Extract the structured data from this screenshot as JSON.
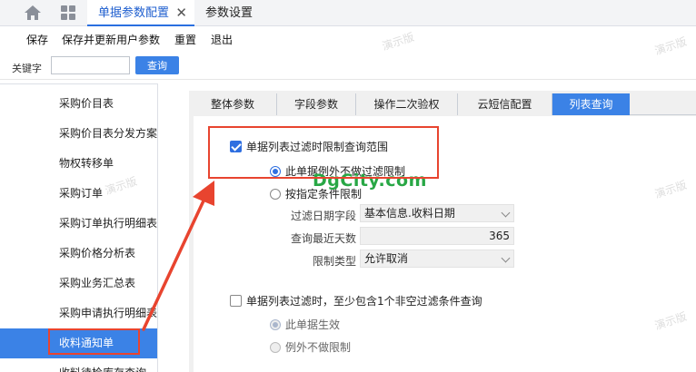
{
  "tabs": {
    "active_label": "单据参数配置",
    "close_symbol": "✕",
    "second_label": "参数设置",
    "home_icon": "home-icon",
    "grid_icon": "apps-grid-icon"
  },
  "toolbar": {
    "save": "保存",
    "save_update": "保存并更新用户参数",
    "reset": "重置",
    "exit": "退出"
  },
  "search": {
    "label": "关键字",
    "value": "",
    "button": "查询"
  },
  "sidebar": {
    "items": [
      {
        "label": "采购价目表"
      },
      {
        "label": "采购价目表分发方案"
      },
      {
        "label": "物权转移单"
      },
      {
        "label": "采购订单"
      },
      {
        "label": "采购订单执行明细表"
      },
      {
        "label": "采购价格分析表"
      },
      {
        "label": "采购业务汇总表"
      },
      {
        "label": "采购申请执行明细表"
      },
      {
        "label": "收料通知单"
      },
      {
        "label": "收料待检库存查询"
      }
    ],
    "selected_index": 8
  },
  "inner_tabs": [
    {
      "label": "整体参数"
    },
    {
      "label": "字段参数"
    },
    {
      "label": "操作二次验权"
    },
    {
      "label": "云短信配置"
    },
    {
      "label": "列表查询"
    }
  ],
  "content": {
    "option1": {
      "label": "单据列表过滤时限制查询范围",
      "checked": true
    },
    "radio1": {
      "label": "此单据例外不做过滤限制",
      "selected": true
    },
    "radio2": {
      "label": "按指定条件限制",
      "selected": false
    },
    "filter_date_field": {
      "label": "过滤日期字段",
      "value": "基本信息.收料日期"
    },
    "recent_days": {
      "label": "查询最近天数",
      "value": "365"
    },
    "limit_type": {
      "label": "限制类型",
      "value": "允许取消"
    },
    "option2": {
      "label": "单据列表过滤时，至少包含1个非空过滤条件查询",
      "checked": false
    },
    "radio3": {
      "label": "此单据生效",
      "selected": true
    },
    "radio4": {
      "label": "例外不做限制",
      "selected": false
    }
  },
  "watermarks": {
    "demo": "演示版",
    "site": "DgCity.com"
  },
  "colors": {
    "accent": "#3b82e6",
    "highlight": "#e8442f",
    "site_watermark": "#28a745"
  }
}
